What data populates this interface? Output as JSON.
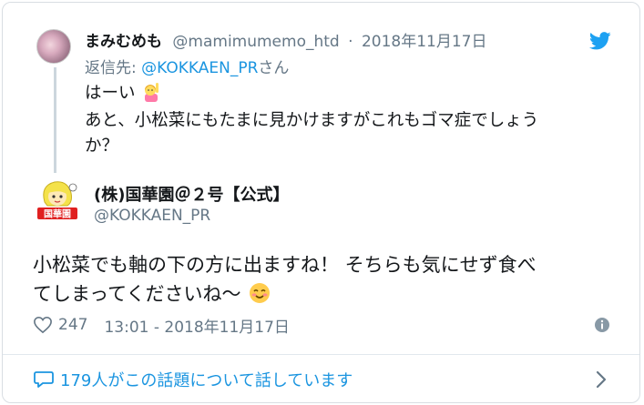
{
  "reply": {
    "name": "まみむめも",
    "handle": "@mamimumemo_htd",
    "separator": "·",
    "date": "2018年11月17日",
    "reply_to_prefix": "返信先:",
    "reply_to_handle": "@KOKKAEN_PR",
    "reply_to_suffix": "さん",
    "line1": "はーい",
    "line2": "あと、小松菜にもたまに見かけますがこれもゴマ症でしょう",
    "line3": "か？"
  },
  "author": {
    "name": "(株)国華園＠２号【公式】",
    "handle": "@KOKKAEN_PR",
    "avatar_label": "国華園"
  },
  "tweet": {
    "line1": "小松菜でも軸の下の方に出ますね！ そちらも気にせず食べ",
    "line2": "てしまってくださいね〜"
  },
  "meta": {
    "likes": "247",
    "time": "13:01 - 2018年11月17日"
  },
  "discussion": {
    "label": "179人がこの話題について話しています"
  },
  "colors": {
    "twitter_blue": "#1da1f2",
    "link_blue": "#1b95e0",
    "muted": "#657786"
  },
  "icons": [
    "twitter-logo-icon",
    "heart-icon",
    "info-icon",
    "speech-bubble-icon",
    "chevron-right-icon"
  ]
}
